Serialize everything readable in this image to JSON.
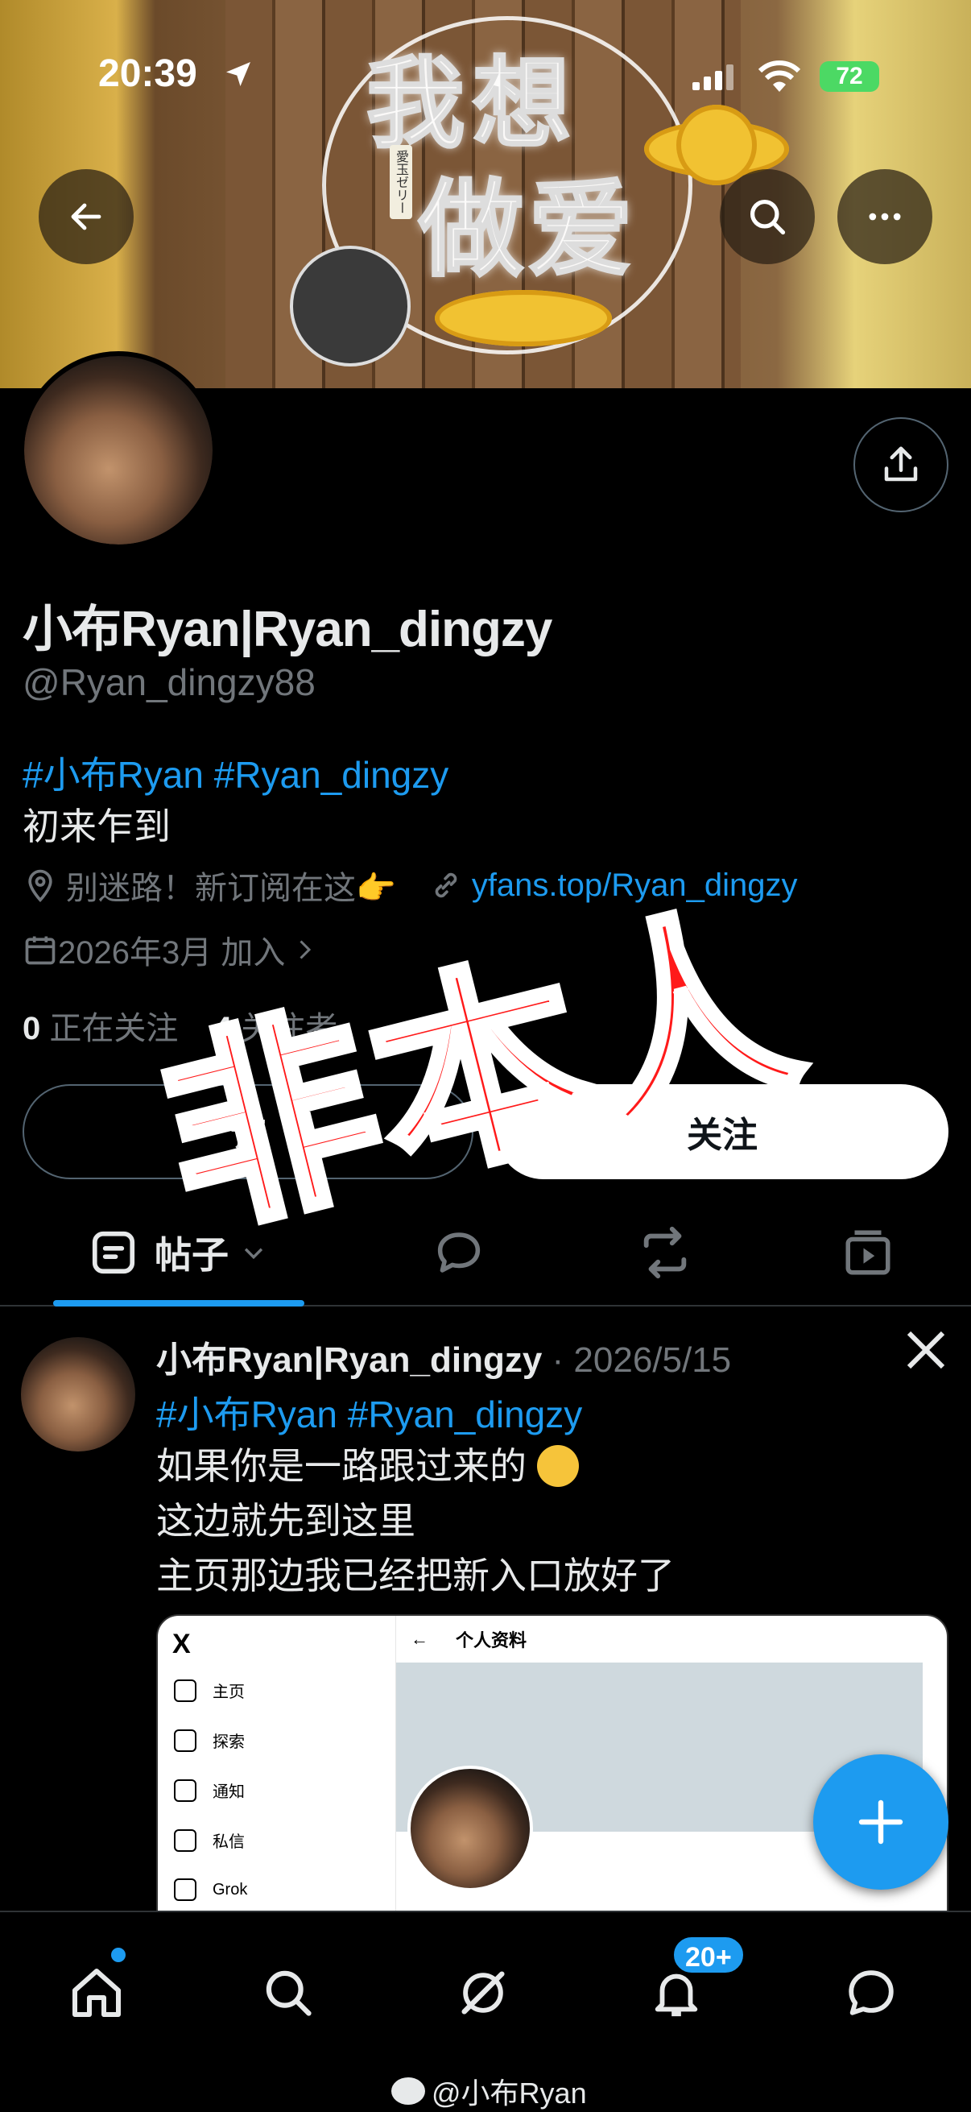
{
  "status_bar": {
    "time": "20:39",
    "battery": "72"
  },
  "banner": {
    "neon_line1": "我想",
    "neon_line2": "做爱",
    "sign_text": "愛玉ゼリー"
  },
  "profile": {
    "display_name": "小布Ryan|Ryan_dingzy",
    "handle": "@Ryan_dingzy88",
    "bio_tags": "#小布Ryan #Ryan_dingzy",
    "bio_text": "初来乍到",
    "location": "别迷路！新订阅在这👉",
    "website": "yfans.top/Ryan_dingzy",
    "joined": "2026年3月 加入",
    "following_count": "0",
    "following_label": "正在关注",
    "followers_count": "4",
    "followers_label": "关注者"
  },
  "actions": {
    "subscribe_label": "订",
    "follow_label": "关注"
  },
  "stamp_text": "非本人",
  "tabs": {
    "posts_label": "帖子"
  },
  "post": {
    "author": "小布Ryan|Ryan_dingzy",
    "date": "· 2026/5/15",
    "tags": "#小布Ryan #Ryan_dingzy",
    "line1": "如果你是一路跟过来的",
    "line2": "这边就先到这里",
    "line3": "主页那边我已经把新入口放好了",
    "embed": {
      "logo": "X",
      "top_title": "个人资料",
      "back": "←",
      "nav": [
        "主页",
        "探索",
        "通知",
        "私信",
        "Grok"
      ]
    }
  },
  "bottom_nav": {
    "notif_badge": "20+"
  },
  "watermark": "@小布Ryan",
  "colors": {
    "accent": "#1d9bf0",
    "stamp": "#ff1a1a",
    "background": "#000000"
  }
}
